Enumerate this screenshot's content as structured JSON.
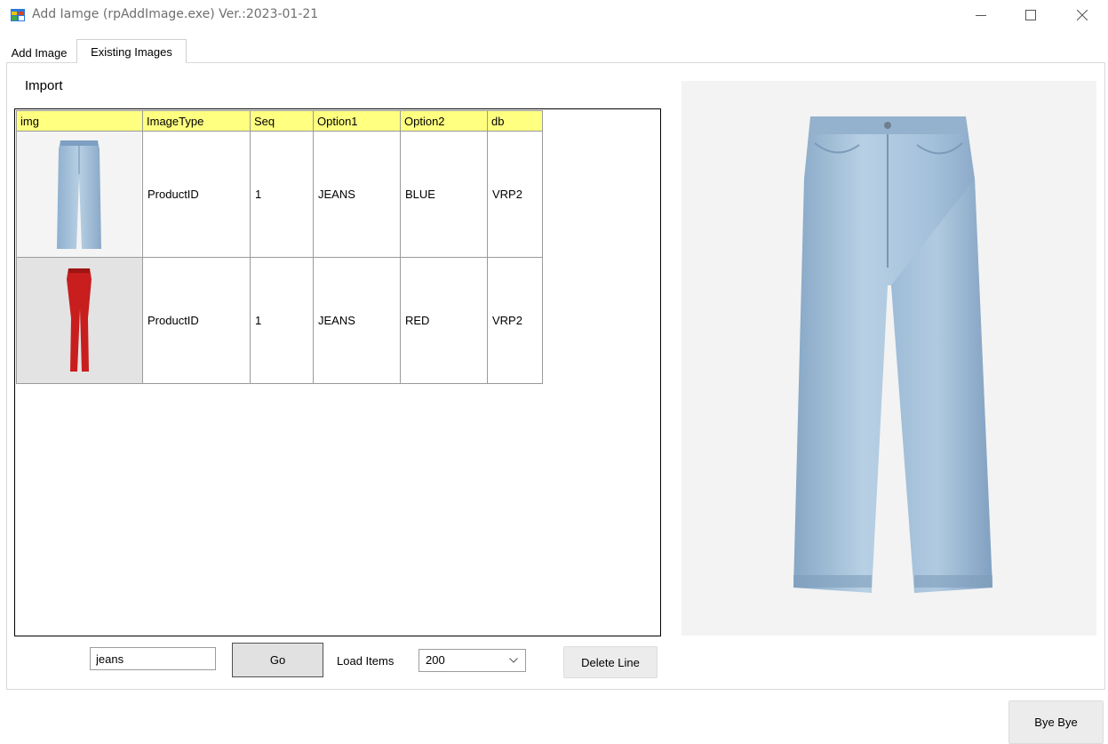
{
  "window": {
    "title": "Add Iamge (rpAddImage.exe) Ver.:2023-01-21",
    "icon": "app-window-icon",
    "controls": [
      "minimize-icon",
      "maximize-icon",
      "close-icon"
    ]
  },
  "tabs": [
    {
      "label": "Add Image",
      "active": false
    },
    {
      "label": "Existing Images",
      "active": true
    }
  ],
  "import_label": "Import",
  "grid": {
    "columns": [
      "img",
      "ImageType",
      "Seq",
      "Option1",
      "Option2",
      "db"
    ],
    "header_color": "#ffff80",
    "rows": [
      {
        "img": "blue-jeans-thumbnail",
        "ImageType": "ProductID",
        "Seq": "1",
        "Option1": "JEANS",
        "Option2": "BLUE",
        "db": "VRP2"
      },
      {
        "img": "red-jeans-thumbnail",
        "ImageType": "ProductID",
        "Seq": "1",
        "Option1": "JEANS",
        "Option2": "RED",
        "db": "VRP2"
      }
    ]
  },
  "preview": {
    "image": "blue-jeans-preview"
  },
  "search": {
    "value": "jeans"
  },
  "go_label": "Go",
  "load_items": {
    "label": "Load Items",
    "selected": "200"
  },
  "delete_label": "Delete Line",
  "bye_label": "Bye Bye",
  "colors": {
    "jeans_blue": "#a9c4dc",
    "jeans_red": "#c81e1e"
  }
}
